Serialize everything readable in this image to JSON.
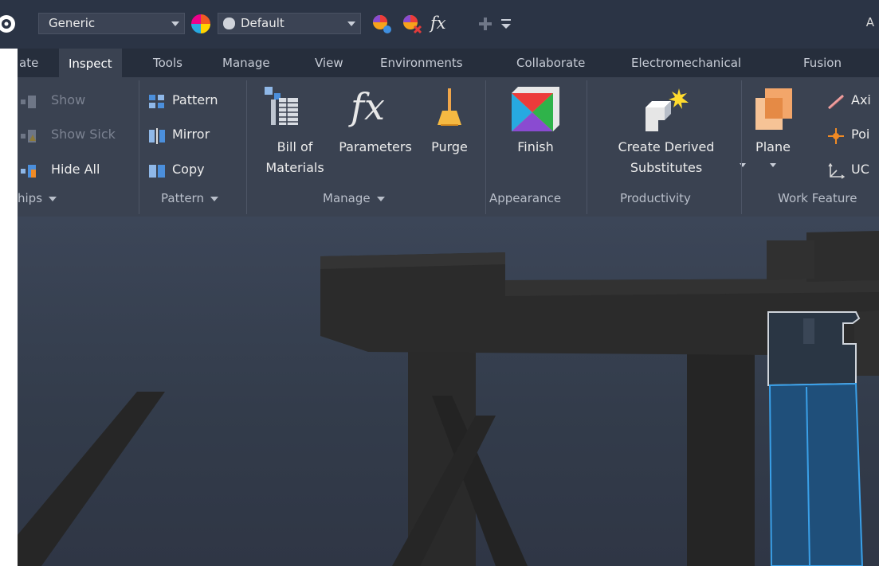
{
  "qat": {
    "material_combo": "Generic",
    "appearance_combo": "Default",
    "fx_label": "fx",
    "title_fragment": "A"
  },
  "tabs": [
    {
      "label": "ate"
    },
    {
      "label": "Inspect",
      "active": true
    },
    {
      "label": "Tools"
    },
    {
      "label": "Manage"
    },
    {
      "label": "View"
    },
    {
      "label": "Environments"
    },
    {
      "label": "Collaborate"
    },
    {
      "label": "Electromechanical"
    },
    {
      "label": "Fusion"
    }
  ],
  "ribbon": {
    "relationships": {
      "group_label": "hips",
      "show": "Show",
      "show_sick": "Show Sick",
      "hide_all": "Hide All"
    },
    "pattern": {
      "group_label": "Pattern",
      "pattern": "Pattern",
      "mirror": "Mirror",
      "copy": "Copy"
    },
    "manage": {
      "group_label": "Manage",
      "bom_line1": "Bill of",
      "bom_line2": "Materials",
      "fx_glyph": "fx",
      "parameters": "Parameters",
      "purge": "Purge"
    },
    "appearance": {
      "group_label": "Appearance",
      "finish": "Finish"
    },
    "productivity": {
      "group_label": "Productivity",
      "derived_line1": "Create Derived",
      "derived_line2": "Substitutes"
    },
    "work_features": {
      "group_label": "Work Feature",
      "plane": "Plane",
      "axis": "Axi",
      "point": "Poi",
      "ucs": "UC"
    }
  },
  "colors": {
    "qat_bg": "#2b3445",
    "tabs_bg": "#262e3c",
    "ribbon_bg": "#3a4251",
    "viewport_top": "#3c4658",
    "selection_blue": "#1f4f7a",
    "selection_edge": "#3aa0e8"
  }
}
